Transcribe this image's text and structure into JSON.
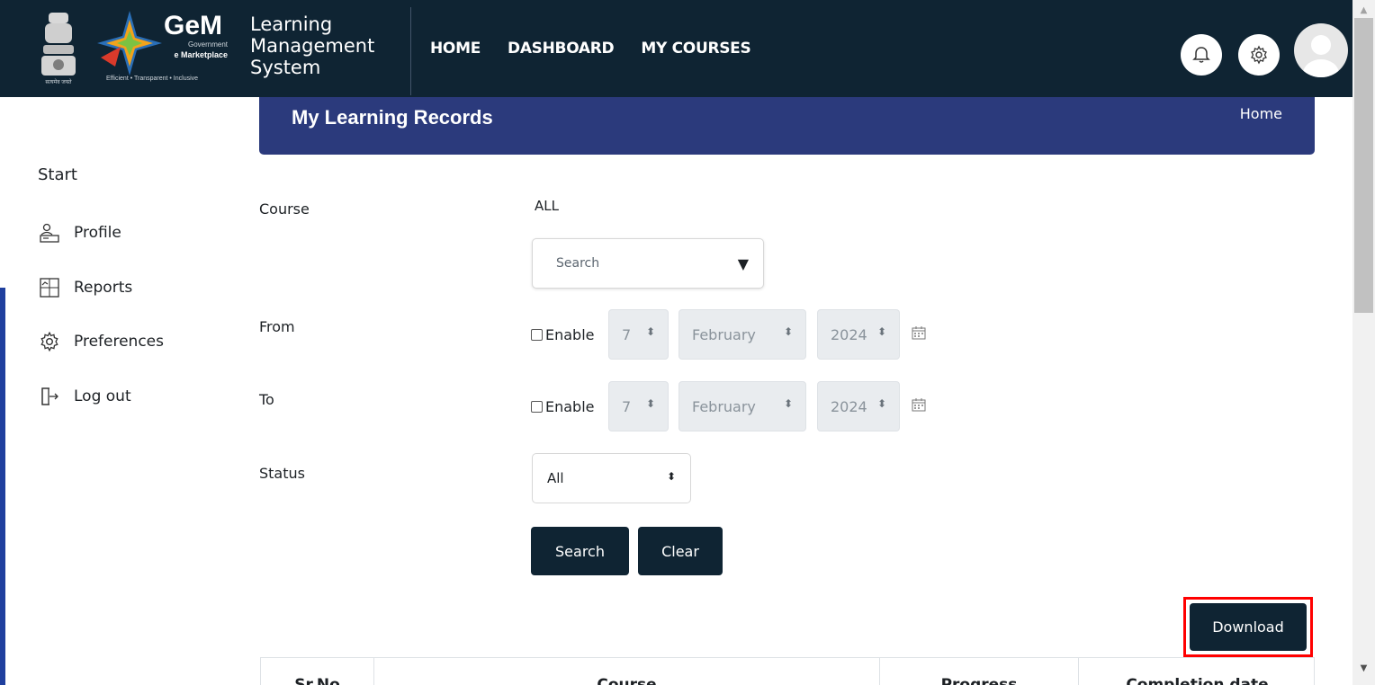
{
  "header": {
    "brand": {
      "emblem_caption": "सत्यमेव जयते",
      "gem_word": "GeM",
      "gem_sub1": "Government",
      "gem_sub2": "e Marketplace",
      "gem_tagline": "Efficient • Transparent • Inclusive"
    },
    "lms_title": [
      "Learning",
      "Management",
      "System"
    ],
    "nav": [
      "HOME",
      "DASHBOARD",
      "MY COURSES"
    ],
    "icons": {
      "notifications": "bell-icon",
      "settings": "gear-icon",
      "user": "avatar"
    }
  },
  "sidebar": {
    "start_label": "Start",
    "items": [
      {
        "label": "Profile",
        "icon": "profile-icon"
      },
      {
        "label": "Reports",
        "icon": "reports-icon"
      },
      {
        "label": "Preferences",
        "icon": "gear-icon"
      },
      {
        "label": "Log out",
        "icon": "logout-icon"
      }
    ]
  },
  "page": {
    "title": "My Learning Records",
    "breadcrumb_home": "Home"
  },
  "filters": {
    "course_label": "Course",
    "course_value": "ALL",
    "course_search_placeholder": "Search",
    "from_label": "From",
    "to_label": "To",
    "enable_label": "Enable",
    "from": {
      "day": "7",
      "month": "February",
      "year": "2024",
      "enabled": false
    },
    "to": {
      "day": "7",
      "month": "February",
      "year": "2024",
      "enabled": false
    },
    "status_label": "Status",
    "status_value": "All",
    "search_button": "Search",
    "clear_button": "Clear"
  },
  "download_button": "Download",
  "table": {
    "headers": [
      "Sr.No",
      "Course",
      "Progress",
      "Completion date"
    ]
  },
  "colors": {
    "header_bg": "#0f2433",
    "banner_bg": "#2b3a7c",
    "highlight": "#ff0000"
  }
}
